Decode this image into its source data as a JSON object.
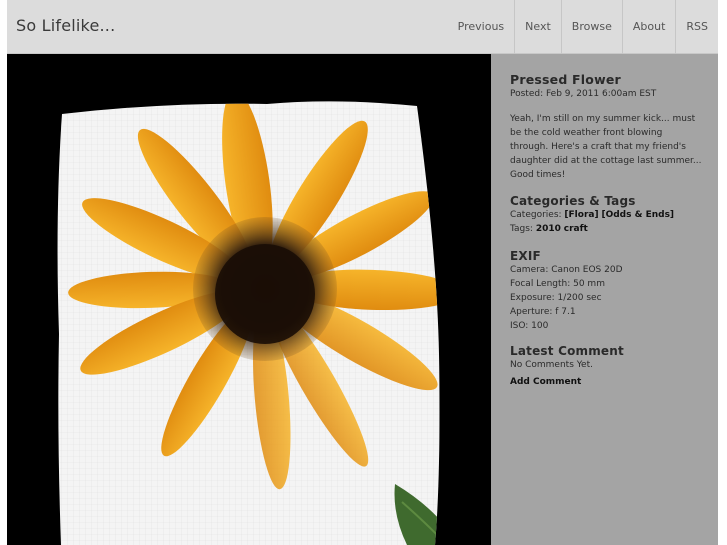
{
  "header": {
    "site_title": "So Lifelike...",
    "nav": [
      "Previous",
      "Next",
      "Browse",
      "About",
      "RSS"
    ]
  },
  "post": {
    "title": "Pressed Flower",
    "posted": "Posted: Feb 9, 2011 6:00am EST",
    "body": "Yeah, I'm still on my summer kick... must be the cold weather front blowing through. Here's a craft that my friend's daughter did at the cottage last summer... Good times!"
  },
  "categories_tags": {
    "heading": "Categories & Tags",
    "categories_label": "Categories:",
    "categories": [
      "[Flora]",
      "[Odds & Ends]"
    ],
    "tags_label": "Tags:",
    "tags": [
      "2010",
      "craft"
    ]
  },
  "exif": {
    "heading": "EXIF",
    "camera": "Camera: Canon EOS 20D",
    "focal_length": "Focal Length: 50 mm",
    "exposure": "Exposure: 1/200 sec",
    "aperture": "Aperture: f 7.1",
    "iso": "ISO: 100"
  },
  "comments": {
    "heading": "Latest Comment",
    "none_text": "No Comments Yet.",
    "add_label": "Add Comment"
  },
  "colors": {
    "header_bg": "#dcdcdc",
    "sidebar_bg": "#a4a4a4",
    "photo_bg": "#000000",
    "petal": "#f2a61a",
    "center": "#2a1a0e"
  }
}
